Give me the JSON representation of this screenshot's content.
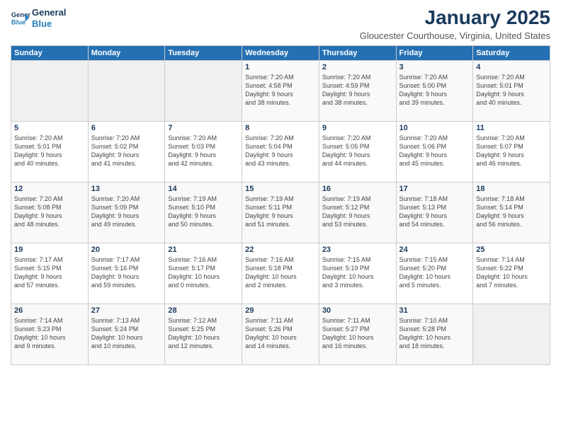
{
  "header": {
    "logo_line1": "General",
    "logo_line2": "Blue",
    "month": "January 2025",
    "location": "Gloucester Courthouse, Virginia, United States"
  },
  "weekdays": [
    "Sunday",
    "Monday",
    "Tuesday",
    "Wednesday",
    "Thursday",
    "Friday",
    "Saturday"
  ],
  "weeks": [
    [
      {
        "day": "",
        "info": ""
      },
      {
        "day": "",
        "info": ""
      },
      {
        "day": "",
        "info": ""
      },
      {
        "day": "1",
        "info": "Sunrise: 7:20 AM\nSunset: 4:58 PM\nDaylight: 9 hours\nand 38 minutes."
      },
      {
        "day": "2",
        "info": "Sunrise: 7:20 AM\nSunset: 4:59 PM\nDaylight: 9 hours\nand 38 minutes."
      },
      {
        "day": "3",
        "info": "Sunrise: 7:20 AM\nSunset: 5:00 PM\nDaylight: 9 hours\nand 39 minutes."
      },
      {
        "day": "4",
        "info": "Sunrise: 7:20 AM\nSunset: 5:01 PM\nDaylight: 9 hours\nand 40 minutes."
      }
    ],
    [
      {
        "day": "5",
        "info": "Sunrise: 7:20 AM\nSunset: 5:01 PM\nDaylight: 9 hours\nand 40 minutes."
      },
      {
        "day": "6",
        "info": "Sunrise: 7:20 AM\nSunset: 5:02 PM\nDaylight: 9 hours\nand 41 minutes."
      },
      {
        "day": "7",
        "info": "Sunrise: 7:20 AM\nSunset: 5:03 PM\nDaylight: 9 hours\nand 42 minutes."
      },
      {
        "day": "8",
        "info": "Sunrise: 7:20 AM\nSunset: 5:04 PM\nDaylight: 9 hours\nand 43 minutes."
      },
      {
        "day": "9",
        "info": "Sunrise: 7:20 AM\nSunset: 5:05 PM\nDaylight: 9 hours\nand 44 minutes."
      },
      {
        "day": "10",
        "info": "Sunrise: 7:20 AM\nSunset: 5:06 PM\nDaylight: 9 hours\nand 45 minutes."
      },
      {
        "day": "11",
        "info": "Sunrise: 7:20 AM\nSunset: 5:07 PM\nDaylight: 9 hours\nand 46 minutes."
      }
    ],
    [
      {
        "day": "12",
        "info": "Sunrise: 7:20 AM\nSunset: 5:08 PM\nDaylight: 9 hours\nand 48 minutes."
      },
      {
        "day": "13",
        "info": "Sunrise: 7:20 AM\nSunset: 5:09 PM\nDaylight: 9 hours\nand 49 minutes."
      },
      {
        "day": "14",
        "info": "Sunrise: 7:19 AM\nSunset: 5:10 PM\nDaylight: 9 hours\nand 50 minutes."
      },
      {
        "day": "15",
        "info": "Sunrise: 7:19 AM\nSunset: 5:11 PM\nDaylight: 9 hours\nand 51 minutes."
      },
      {
        "day": "16",
        "info": "Sunrise: 7:19 AM\nSunset: 5:12 PM\nDaylight: 9 hours\nand 53 minutes."
      },
      {
        "day": "17",
        "info": "Sunrise: 7:18 AM\nSunset: 5:13 PM\nDaylight: 9 hours\nand 54 minutes."
      },
      {
        "day": "18",
        "info": "Sunrise: 7:18 AM\nSunset: 5:14 PM\nDaylight: 9 hours\nand 56 minutes."
      }
    ],
    [
      {
        "day": "19",
        "info": "Sunrise: 7:17 AM\nSunset: 5:15 PM\nDaylight: 9 hours\nand 57 minutes."
      },
      {
        "day": "20",
        "info": "Sunrise: 7:17 AM\nSunset: 5:16 PM\nDaylight: 9 hours\nand 59 minutes."
      },
      {
        "day": "21",
        "info": "Sunrise: 7:16 AM\nSunset: 5:17 PM\nDaylight: 10 hours\nand 0 minutes."
      },
      {
        "day": "22",
        "info": "Sunrise: 7:16 AM\nSunset: 5:18 PM\nDaylight: 10 hours\nand 2 minutes."
      },
      {
        "day": "23",
        "info": "Sunrise: 7:15 AM\nSunset: 5:19 PM\nDaylight: 10 hours\nand 3 minutes."
      },
      {
        "day": "24",
        "info": "Sunrise: 7:15 AM\nSunset: 5:20 PM\nDaylight: 10 hours\nand 5 minutes."
      },
      {
        "day": "25",
        "info": "Sunrise: 7:14 AM\nSunset: 5:22 PM\nDaylight: 10 hours\nand 7 minutes."
      }
    ],
    [
      {
        "day": "26",
        "info": "Sunrise: 7:14 AM\nSunset: 5:23 PM\nDaylight: 10 hours\nand 9 minutes."
      },
      {
        "day": "27",
        "info": "Sunrise: 7:13 AM\nSunset: 5:24 PM\nDaylight: 10 hours\nand 10 minutes."
      },
      {
        "day": "28",
        "info": "Sunrise: 7:12 AM\nSunset: 5:25 PM\nDaylight: 10 hours\nand 12 minutes."
      },
      {
        "day": "29",
        "info": "Sunrise: 7:11 AM\nSunset: 5:26 PM\nDaylight: 10 hours\nand 14 minutes."
      },
      {
        "day": "30",
        "info": "Sunrise: 7:11 AM\nSunset: 5:27 PM\nDaylight: 10 hours\nand 16 minutes."
      },
      {
        "day": "31",
        "info": "Sunrise: 7:10 AM\nSunset: 5:28 PM\nDaylight: 10 hours\nand 18 minutes."
      },
      {
        "day": "",
        "info": ""
      }
    ]
  ]
}
